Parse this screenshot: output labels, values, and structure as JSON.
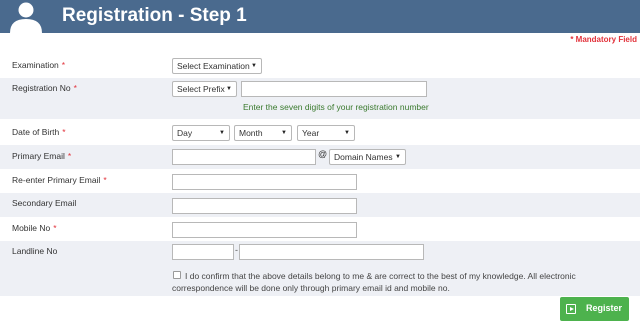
{
  "header": {
    "title": "Registration - Step 1",
    "avatar_icon": "user-silhouette-icon"
  },
  "mandatory_note": "* Mandatory Field",
  "fields": {
    "examination": {
      "label": "Examination",
      "required": "*",
      "select": "Select Examination"
    },
    "registration_no": {
      "label": "Registration No",
      "required": "*",
      "prefix_select": "Select Prefix",
      "hint": "Enter the seven digits of your registration number"
    },
    "dob": {
      "label": "Date of Birth",
      "required": "*",
      "day": "Day",
      "month": "Month",
      "year": "Year"
    },
    "primary_email": {
      "label": "Primary Email",
      "required": "*",
      "at": "@",
      "domain_select": "Domain Names"
    },
    "reenter_email": {
      "label": "Re-enter Primary Email",
      "required": "*"
    },
    "secondary_email": {
      "label": "Secondary Email"
    },
    "mobile": {
      "label": "Mobile No",
      "required": "*"
    },
    "landline": {
      "label": "Landline No",
      "separator": "-"
    }
  },
  "confirm_text": "I do confirm that the above details belong to me & are correct to the best of my knowledge. All electronic correspondence will be done only through primary email id and mobile no.",
  "register_button": {
    "label": "Register"
  },
  "colors": {
    "header": "#4a6a8e",
    "required": "#e2323b",
    "hint": "#3a7a2e",
    "register": "#4db24d",
    "row_shade": "#eef0f5"
  }
}
